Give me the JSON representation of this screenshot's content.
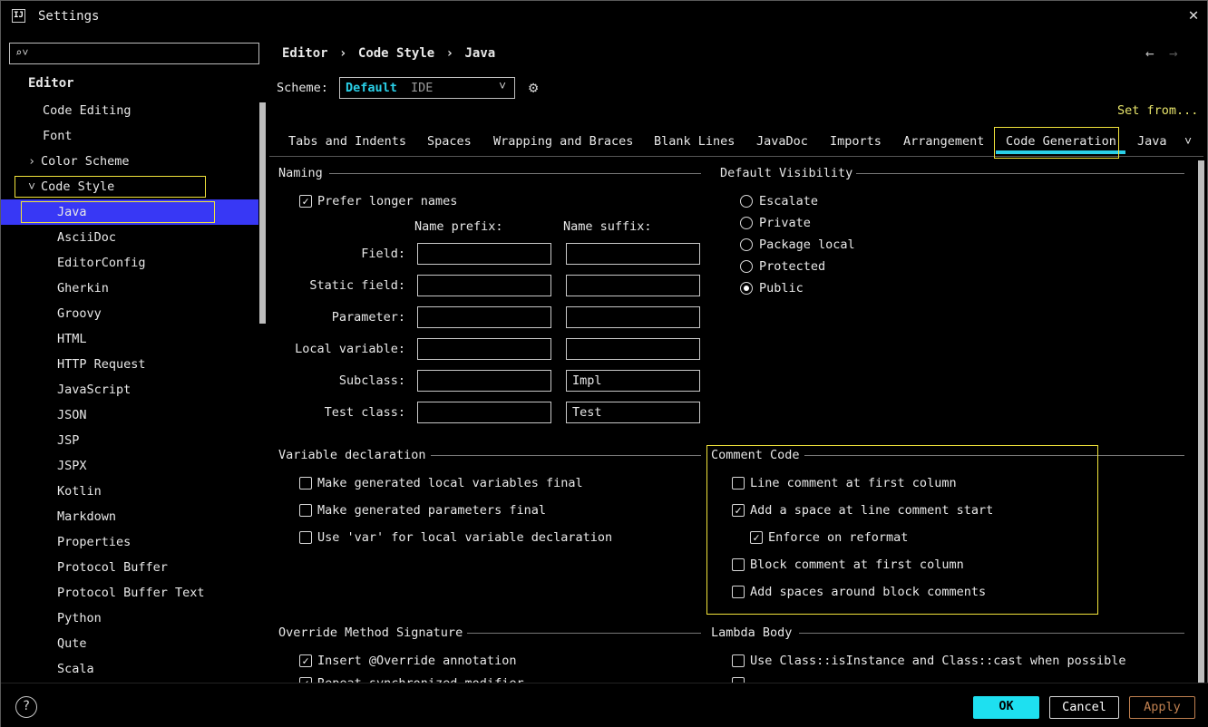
{
  "window": {
    "title": "Settings",
    "app_icon": "IJ"
  },
  "sidebar": {
    "search_placeholder": "",
    "section": "Editor",
    "items": [
      {
        "label": "Code Editing"
      },
      {
        "label": "Font"
      },
      {
        "label": "Color Scheme"
      },
      {
        "label": "Code Style"
      },
      {
        "label": "Java"
      },
      {
        "label": "AsciiDoc"
      },
      {
        "label": "EditorConfig"
      },
      {
        "label": "Gherkin"
      },
      {
        "label": "Groovy"
      },
      {
        "label": "HTML"
      },
      {
        "label": "HTTP Request"
      },
      {
        "label": "JavaScript"
      },
      {
        "label": "JSON"
      },
      {
        "label": "JSP"
      },
      {
        "label": "JSPX"
      },
      {
        "label": "Kotlin"
      },
      {
        "label": "Markdown"
      },
      {
        "label": "Properties"
      },
      {
        "label": "Protocol Buffer"
      },
      {
        "label": "Protocol Buffer Text"
      },
      {
        "label": "Python"
      },
      {
        "label": "Qute"
      },
      {
        "label": "Scala"
      }
    ]
  },
  "header": {
    "breadcrumb": [
      "Editor",
      "Code Style",
      "Java"
    ],
    "scheme_label": "Scheme:",
    "scheme_value": "Default",
    "scheme_sub": "IDE",
    "set_from": "Set from..."
  },
  "tabs": [
    "Tabs and Indents",
    "Spaces",
    "Wrapping and Braces",
    "Blank Lines",
    "JavaDoc",
    "Imports",
    "Arrangement",
    "Code Generation",
    "Java"
  ],
  "naming": {
    "title": "Naming",
    "prefer_longer": "Prefer longer names",
    "prefix_header": "Name prefix:",
    "suffix_header": "Name suffix:",
    "rows": [
      {
        "label": "Field:",
        "prefix": "",
        "suffix": ""
      },
      {
        "label": "Static field:",
        "prefix": "",
        "suffix": ""
      },
      {
        "label": "Parameter:",
        "prefix": "",
        "suffix": ""
      },
      {
        "label": "Local variable:",
        "prefix": "",
        "suffix": ""
      },
      {
        "label": "Subclass:",
        "prefix": "",
        "suffix": "Impl"
      },
      {
        "label": "Test class:",
        "prefix": "",
        "suffix": "Test"
      }
    ]
  },
  "visibility": {
    "title": "Default Visibility",
    "options": [
      "Escalate",
      "Private",
      "Package local",
      "Protected",
      "Public"
    ],
    "selected": "Public"
  },
  "variable_decl": {
    "title": "Variable declaration",
    "items": [
      {
        "label": "Make generated local variables final",
        "checked": false
      },
      {
        "label": "Make generated parameters final",
        "checked": false
      },
      {
        "label": "Use 'var' for local variable declaration",
        "checked": false
      }
    ]
  },
  "comment_code": {
    "title": "Comment Code",
    "items": [
      {
        "label": "Line comment at first column",
        "checked": false
      },
      {
        "label": "Add a space at line comment start",
        "checked": true
      },
      {
        "label": "Enforce on reformat",
        "checked": true
      },
      {
        "label": "Block comment at first column",
        "checked": false
      },
      {
        "label": "Add spaces around block comments",
        "checked": false
      }
    ]
  },
  "override": {
    "title": "Override Method Signature",
    "items": [
      {
        "label": "Insert @Override annotation",
        "checked": true
      },
      {
        "label": "Repeat synchronized modifier",
        "checked": true
      }
    ]
  },
  "lambda": {
    "title": "Lambda Body",
    "items": [
      {
        "label": "Use Class::isInstance and Class::cast when possible",
        "checked": false
      }
    ]
  },
  "footer": {
    "help": "?",
    "ok": "OK",
    "cancel": "Cancel",
    "apply": "Apply"
  },
  "colors": {
    "accent": "#2ad0e8",
    "selection": "#3838f5",
    "highlight_box": "#f2e43b",
    "apply_text": "#c08050"
  }
}
